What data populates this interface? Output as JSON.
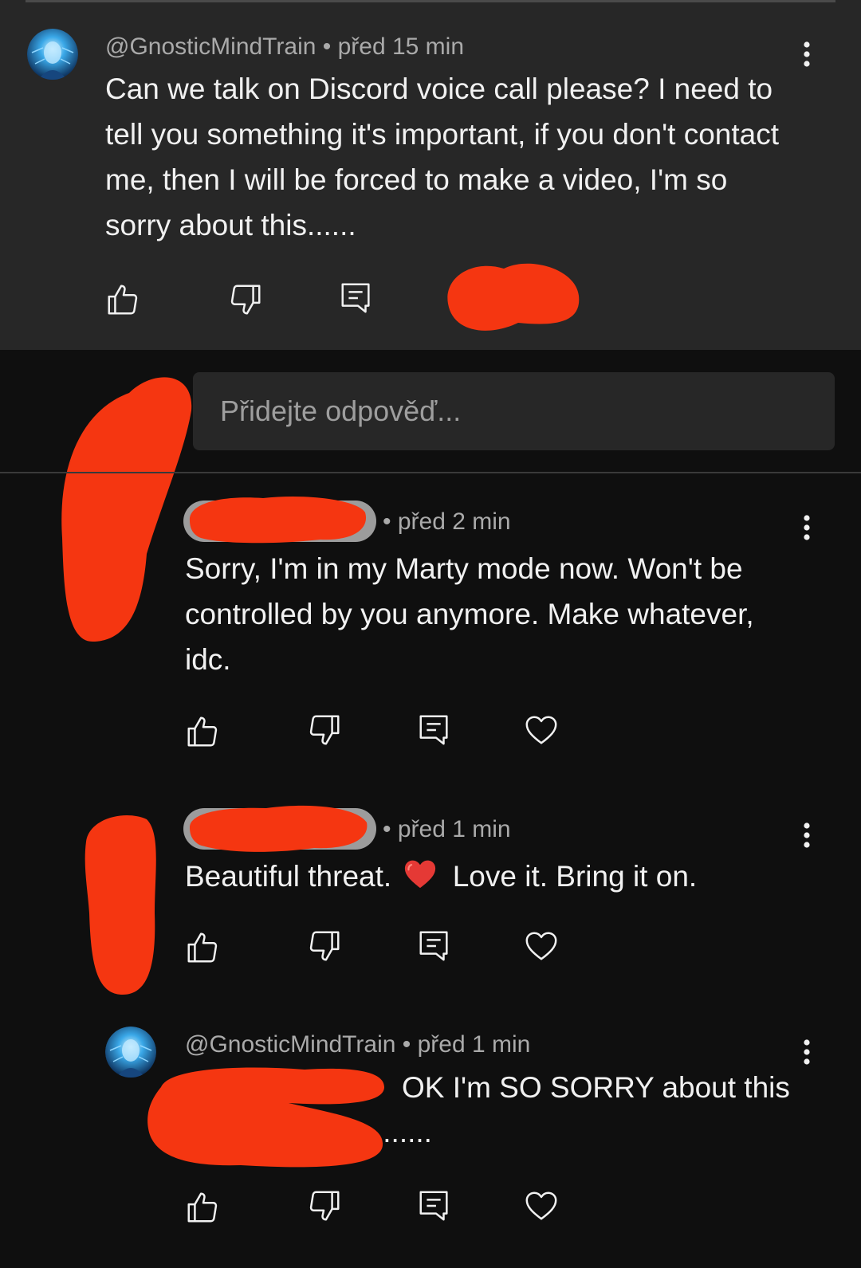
{
  "thread": {
    "parent": {
      "author": "@GnosticMindTrain",
      "time": "• před 15 min",
      "text": "Can we talk on Discord voice call please? I need to tell you something it's important, if you don't contact me, then I will be forced to make a video, I'm so sorry about this......"
    },
    "reply_input": {
      "placeholder": "Přidejte odpověď..."
    },
    "replies": [
      {
        "author": "",
        "time": "• před 2 min",
        "text": "Sorry, I'm in my Marty mode now. Won't be controlled by you anymore. Make whatever, idc."
      },
      {
        "author": "",
        "time": "• před 1 min",
        "text_before": "Beautiful threat.",
        "text_after": "Love it. Bring it on."
      },
      {
        "author": "@GnosticMindTrain",
        "time": "• před 1 min",
        "text_line1": "OK I'm SO SORRY about this",
        "text_line2": "......."
      }
    ]
  },
  "icons": {
    "like": "thumb-up-icon",
    "dislike": "thumb-down-icon",
    "reply": "comment-icon",
    "heart": "heart-outline-icon",
    "more": "vertical-dots-icon"
  },
  "colors": {
    "background": "#0f0f0f",
    "parent_background": "#272727",
    "redaction": "#f53611",
    "emoji_heart": "#e53935"
  }
}
